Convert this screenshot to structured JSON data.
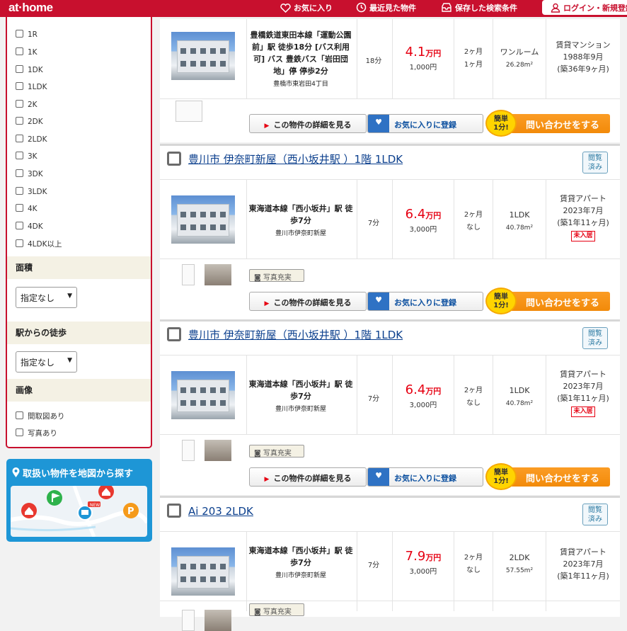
{
  "header": {
    "logo": "at·home",
    "favorites": "お気に入り",
    "recent": "最近見た物件",
    "saved": "保存した検索条件",
    "login": "ログイン・新規登録"
  },
  "sidebar": {
    "layouts": [
      "1R",
      "1K",
      "1DK",
      "1LDK",
      "2K",
      "2DK",
      "2LDK",
      "3K",
      "3DK",
      "3LDK",
      "4K",
      "4DK",
      "4LDK以上"
    ],
    "area_heading": "面積",
    "area_select": "指定なし",
    "walk_heading": "駅からの徒歩",
    "walk_select": "指定なし",
    "image_heading": "画像",
    "image_opts": [
      "間取図あり",
      "写真あり"
    ]
  },
  "map_banner": {
    "title": "取扱い物件を地図から探す",
    "new_badge": "NEW"
  },
  "buttons": {
    "detail": "この物件の詳細を見る",
    "favorite": "お気に入りに登録",
    "inquiry": "問い合わせをする",
    "easy_line1": "簡単",
    "easy_line2": "1分!",
    "photo_tag": "写真充実",
    "viewed_1": "閲覧",
    "viewed_2": "済み"
  },
  "listings": [
    {
      "title": "",
      "access_line": "豊橋鉄道東田本線「運動公園前」駅 徒歩18分 [バス利用可] バス 豊鉄バス「岩田団地」停 停歩2分",
      "address": "豊橋市東岩田4丁目",
      "walk": "18分",
      "rent": "4.1",
      "rent_unit": "万円",
      "fee": "1,000円",
      "deposit": "2ヶ月",
      "key_money": "1ヶ月",
      "layout": "ワンルーム",
      "area": "26.28m²",
      "type": "賃貸マンション",
      "built": "1988年9月",
      "age": "(築36年9ヶ月)",
      "badge": ""
    },
    {
      "title": "豊川市 伊奈町新屋（西小坂井駅 ）1階 1LDK",
      "access_line": "東海道本線「西小坂井」駅 徒歩7分",
      "address": "豊川市伊奈町新屋",
      "walk": "7分",
      "rent": "6.4",
      "rent_unit": "万円",
      "fee": "3,000円",
      "deposit": "2ヶ月",
      "key_money": "なし",
      "layout": "1LDK",
      "area": "40.78m²",
      "type": "賃貸アパート",
      "built": "2023年7月",
      "age": "(築1年11ヶ月)",
      "badge": "未入居"
    },
    {
      "title": "豊川市 伊奈町新屋（西小坂井駅 ）1階 1LDK",
      "access_line": "東海道本線「西小坂井」駅 徒歩7分",
      "address": "豊川市伊奈町新屋",
      "walk": "7分",
      "rent": "6.4",
      "rent_unit": "万円",
      "fee": "3,000円",
      "deposit": "2ヶ月",
      "key_money": "なし",
      "layout": "1LDK",
      "area": "40.78m²",
      "type": "賃貸アパート",
      "built": "2023年7月",
      "age": "(築1年11ヶ月)",
      "badge": "未入居"
    },
    {
      "title": "Ai 203 2LDK",
      "access_line": "東海道本線「西小坂井」駅 徒歩7分",
      "address": "豊川市伊奈町新屋",
      "walk": "7分",
      "rent": "7.9",
      "rent_unit": "万円",
      "fee": "3,000円",
      "deposit": "2ヶ月",
      "key_money": "なし",
      "layout": "2LDK",
      "area": "57.55m²",
      "type": "賃貸アパート",
      "built": "2023年7月",
      "age": "(築1年11ヶ月)",
      "badge": ""
    }
  ],
  "colors": {
    "brand": "#c8102e",
    "price": "#e60012",
    "link": "#0b3f8d",
    "inquiry": "#f28a0a",
    "map": "#1e96d6"
  }
}
